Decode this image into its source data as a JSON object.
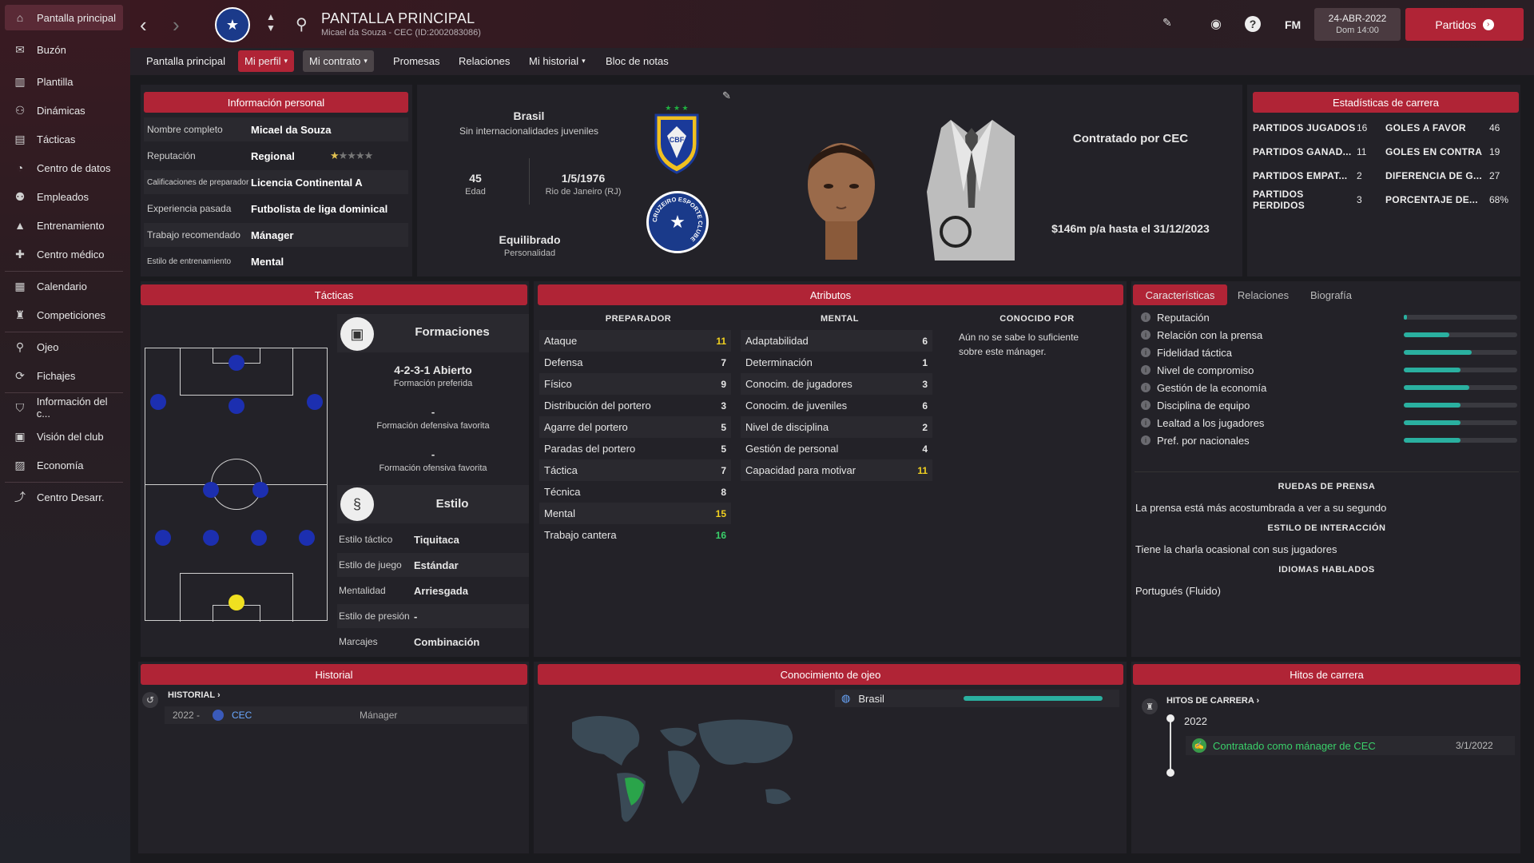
{
  "sidebar": {
    "items": [
      {
        "label": "Pantalla principal",
        "icon": "home-icon"
      },
      {
        "label": "Buzón",
        "icon": "inbox-icon"
      },
      {
        "label": "Plantilla",
        "icon": "squad-icon"
      },
      {
        "label": "Dinámicas",
        "icon": "dynamics-icon"
      },
      {
        "label": "Tácticas",
        "icon": "tactics-icon"
      },
      {
        "label": "Centro de datos",
        "icon": "data-icon"
      },
      {
        "label": "Empleados",
        "icon": "staff-icon"
      },
      {
        "label": "Entrenamiento",
        "icon": "training-icon"
      },
      {
        "label": "Centro médico",
        "icon": "medical-icon"
      },
      {
        "label": "Calendario",
        "icon": "calendar-icon"
      },
      {
        "label": "Competiciones",
        "icon": "trophy-icon"
      },
      {
        "label": "Ojeo",
        "icon": "scouting-icon"
      },
      {
        "label": "Fichajes",
        "icon": "transfers-icon"
      },
      {
        "label": "Información del c...",
        "icon": "club-info-icon"
      },
      {
        "label": "Visión del club",
        "icon": "club-vision-icon"
      },
      {
        "label": "Economía",
        "icon": "finances-icon"
      },
      {
        "label": "Centro Desarr.",
        "icon": "development-icon"
      }
    ]
  },
  "header": {
    "title": "PANTALLA PRINCIPAL",
    "subtitle": "Micael da Souza - CEC (ID:2002083086)",
    "fm_logo": "FM",
    "date": "24-ABR-2022",
    "day_time": "Dom 14:00",
    "continue_label": "Partidos"
  },
  "tabs": [
    {
      "label": "Pantalla principal"
    },
    {
      "label": "Mi perfil"
    },
    {
      "label": "Mi contrato"
    },
    {
      "label": "Promesas"
    },
    {
      "label": "Relaciones"
    },
    {
      "label": "Mi historial"
    },
    {
      "label": "Bloc de notas"
    }
  ],
  "personal": {
    "header": "Información personal",
    "rows": [
      {
        "key": "Nombre completo",
        "value": "Micael da Souza"
      },
      {
        "key": "Reputación",
        "value": "Regional"
      },
      {
        "key": "Calificaciones de preparador",
        "value": "Licencia Continental A"
      },
      {
        "key": "Experiencia pasada",
        "value": "Futbolista de liga dominical"
      },
      {
        "key": "Trabajo recomendado",
        "value": "Mánager"
      },
      {
        "key": "Estilo de entrenamiento",
        "value": "Mental"
      }
    ],
    "reputation_stars": 0.5
  },
  "profile": {
    "nation": "Brasil",
    "caps": "Sin internacionalidades juveniles",
    "age": "45",
    "age_label": "Edad",
    "dob": "1/5/1976",
    "birthplace": "Rio de Janeiro (RJ)",
    "personality": "Equilibrado",
    "personality_label": "Personalidad",
    "cbf_text": "CBF",
    "club_ring_text": "CRUZEIRO ESPORTE CLUBE",
    "contract_title": "Contratado por CEC",
    "contract_wage": "$146m p/a hasta el 31/12/2023"
  },
  "career_stats": {
    "header": "Estadísticas de carrera",
    "left": [
      {
        "label": "PARTIDOS JUGADOS",
        "value": "16"
      },
      {
        "label": "PARTIDOS GANAD...",
        "value": "11"
      },
      {
        "label": "PARTIDOS EMPAT...",
        "value": "2"
      },
      {
        "label": "PARTIDOS PERDIDOS",
        "value": "3"
      }
    ],
    "right": [
      {
        "label": "GOLES A FAVOR",
        "value": "46"
      },
      {
        "label": "GOLES EN CONTRA",
        "value": "19"
      },
      {
        "label": "DIFERENCIA DE G...",
        "value": "27"
      },
      {
        "label": "PORCENTAJE DE...",
        "value": "68%"
      }
    ]
  },
  "tactics": {
    "header": "Tácticas",
    "formations_title": "Formaciones",
    "preferred": "4-2-3-1 Abierto",
    "preferred_label": "Formación preferida",
    "defensive": "-",
    "defensive_label": "Formación defensiva favorita",
    "offensive": "-",
    "offensive_label": "Formación ofensiva favorita",
    "style_title": "Estilo",
    "style_rows": [
      {
        "key": "Estilo táctico",
        "value": "Tiquitaca"
      },
      {
        "key": "Estilo de juego",
        "value": "Estándar"
      },
      {
        "key": "Mentalidad",
        "value": "Arriesgada"
      },
      {
        "key": "Estilo de presión",
        "value": "-"
      },
      {
        "key": "Marcajes",
        "value": "Combinación"
      }
    ]
  },
  "attributes": {
    "header": "Atributos",
    "coach_title": "PREPARADOR",
    "mental_title": "MENTAL",
    "known_title": "CONOCIDO POR",
    "known_text": "Aún no se sabe lo suficiente sobre este mánager.",
    "coach": [
      {
        "label": "Ataque",
        "value": "11"
      },
      {
        "label": "Defensa",
        "value": "7"
      },
      {
        "label": "Físico",
        "value": "9"
      },
      {
        "label": "Distribución del portero",
        "value": "3"
      },
      {
        "label": "Agarre del portero",
        "value": "5"
      },
      {
        "label": "Paradas del portero",
        "value": "5"
      },
      {
        "label": "Táctica",
        "value": "7"
      },
      {
        "label": "Técnica",
        "value": "8"
      },
      {
        "label": "Mental",
        "value": "15"
      },
      {
        "label": "Trabajo cantera",
        "value": "16"
      }
    ],
    "mental": [
      {
        "label": "Adaptabilidad",
        "value": "6"
      },
      {
        "label": "Determinación",
        "value": "1"
      },
      {
        "label": "Conocim. de jugadores",
        "value": "3"
      },
      {
        "label": "Conocim. de juveniles",
        "value": "6"
      },
      {
        "label": "Nivel de disciplina",
        "value": "2"
      },
      {
        "label": "Gestión de personal",
        "value": "4"
      },
      {
        "label": "Capacidad para motivar",
        "value": "11"
      }
    ]
  },
  "traits": {
    "tabs": [
      "Características",
      "Relaciones",
      "Biografía"
    ],
    "items": [
      {
        "label": "Reputación",
        "level": 0.03
      },
      {
        "label": "Relación con la prensa",
        "level": 0.4
      },
      {
        "label": "Fidelidad táctica",
        "level": 0.6
      },
      {
        "label": "Nivel de compromiso",
        "level": 0.5
      },
      {
        "label": "Gestión de la economía",
        "level": 0.58
      },
      {
        "label": "Disciplina de equipo",
        "level": 0.5
      },
      {
        "label": "Lealtad a los jugadores",
        "level": 0.5
      },
      {
        "label": "Pref. por nacionales",
        "level": 0.5
      }
    ],
    "press_title": "RUEDAS DE PRENSA",
    "press_text": "La prensa está más acostumbrada a ver a su segundo",
    "interaction_title": "ESTILO DE INTERACCIÓN",
    "interaction_text": "Tiene la charla ocasional con sus jugadores",
    "languages_title": "IDIOMAS HABLADOS",
    "languages_text": "Portugués (Fluido)"
  },
  "history": {
    "header": "Historial",
    "link": "HISTORIAL",
    "rows": [
      {
        "years": "2022 -",
        "club": "CEC",
        "role": "Mánager"
      }
    ]
  },
  "scouting": {
    "header": "Conocimiento de ojeo",
    "nation": "Brasil",
    "level": 1.0
  },
  "milestones": {
    "header": "Hitos de carrera",
    "link": "HITOS DE CARRERA",
    "year": "2022",
    "event": "Contratado como mánager de CEC",
    "date": "3/1/2022"
  },
  "colors": {
    "accent": "#b02436",
    "bar": "#2ab0a0",
    "yellow_attr": "#f0d020",
    "green_attr": "#3ad06a"
  }
}
